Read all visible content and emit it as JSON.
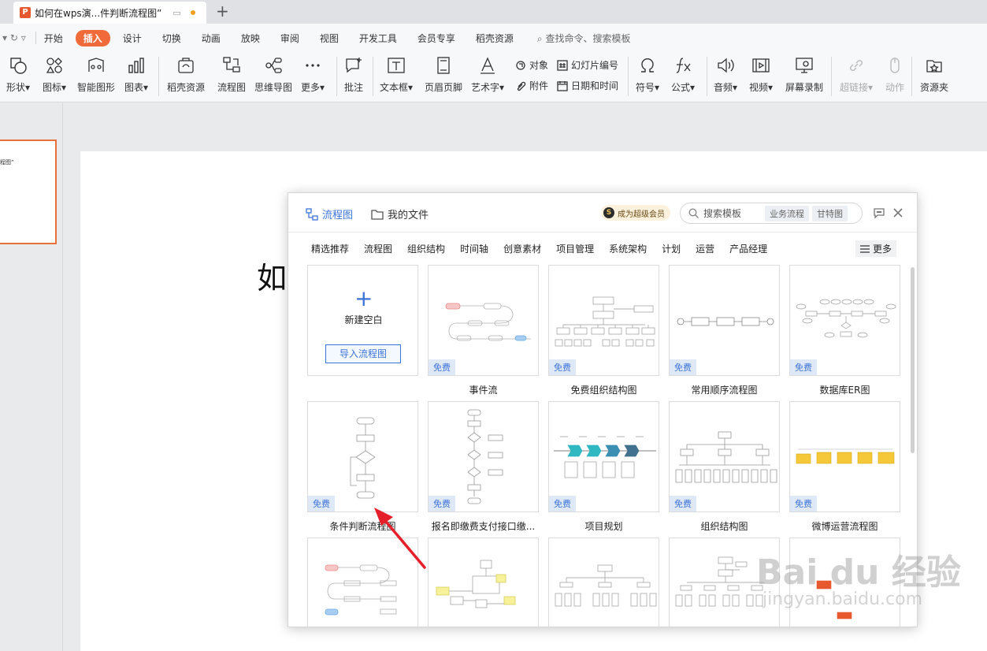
{
  "titlebar": {
    "tab_title": "如何在wps演...件判断流程图”",
    "app_logo": "P",
    "new_tab": "+"
  },
  "menubar": {
    "quick_access": "▾ ↻ ▿",
    "items": [
      "开始",
      "插入",
      "设计",
      "切换",
      "动画",
      "放映",
      "审阅",
      "视图",
      "开发工具",
      "会员专享",
      "稻壳资源"
    ],
    "active_index": 1,
    "search_label": "查找命令、搜索模板"
  },
  "ribbon": {
    "shape": "形状",
    "icon": "图标",
    "smart_shape": "智能图形",
    "chart": "图表",
    "daoke": "稻壳资源",
    "flowchart": "流程图",
    "mindmap": "思维导图",
    "more": "更多",
    "comment": "批注",
    "textbox": "文本框",
    "header_footer": "页眉页脚",
    "wordart": "艺术字",
    "object": "对象",
    "attachment": "附件",
    "slide_number": "幻灯片编号",
    "datetime": "日期和时间",
    "symbol": "符号",
    "formula": "公式",
    "audio": "音频",
    "video": "视频",
    "screen_record": "屏幕录制",
    "hyperlink": "超链接",
    "action": "动作",
    "resource": "资源夹"
  },
  "slide": {
    "thumb_text": "程图”",
    "big_text": "如"
  },
  "dialog": {
    "tab_flowchart": "流程图",
    "tab_myfiles": "我的文件",
    "vip_label": "成为超级会员",
    "vip_icon": "S",
    "search_placeholder": "搜索模板",
    "chip_business": "业务流程",
    "chip_gantt": "甘特图",
    "categories": [
      "精选推荐",
      "流程图",
      "组织结构",
      "时间轴",
      "创意素材",
      "项目管理",
      "系统架构",
      "计划",
      "运营",
      "产品经理"
    ],
    "more_label": "更多",
    "blank_plus": "+",
    "blank_label": "新建空白",
    "import_label": "导入流程图",
    "free_label": "免费",
    "templates_row1": [
      "事件流",
      "免费组织结构图",
      "常用顺序流程图",
      "数据库ER图"
    ],
    "templates_row2": [
      "条件判断流程图",
      "报名即缴费支付接口缴...",
      "项目规划",
      "组织结构图",
      "微博运营流程图"
    ]
  },
  "watermark": {
    "brand": "Bai du 经验",
    "url": "jingyan.baidu.com"
  },
  "colors": {
    "accent_blue": "#3d74d9",
    "active_menu": "#f06a3a",
    "arrow_red": "#e5202a"
  }
}
